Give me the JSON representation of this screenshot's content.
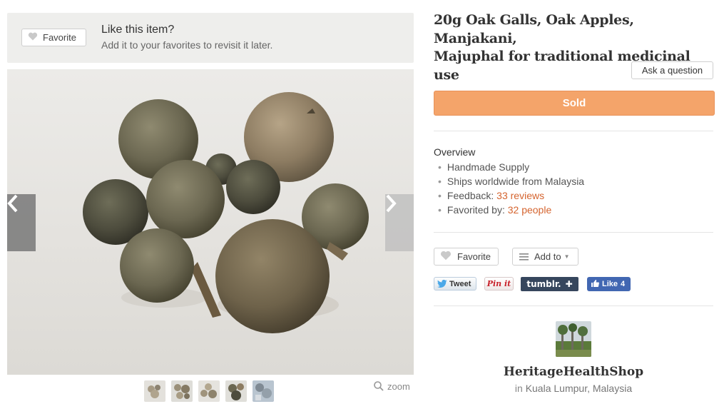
{
  "like_banner": {
    "favorite_label": "Favorite",
    "title": "Like this item?",
    "subtitle": "Add it to your favorites to revisit it later."
  },
  "gallery": {
    "thumbnail_count": 5,
    "zoom_label": "zoom"
  },
  "listing": {
    "title_line1": "20g Oak Galls, Oak Apples, Manjakani,",
    "title_line2": "Majuphal for traditional medicinal use",
    "ask_label": "Ask a question",
    "status_label": "Sold"
  },
  "overview": {
    "heading": "Overview",
    "items": [
      {
        "text": "Handmade Supply",
        "link": ""
      },
      {
        "text": "Ships worldwide from Malaysia",
        "link": ""
      },
      {
        "text": "Feedback: ",
        "link": "33 reviews"
      },
      {
        "text": "Favorited by: ",
        "link": "32 people"
      }
    ]
  },
  "actions": {
    "favorite_label": "Favorite",
    "add_to_label": "Add to"
  },
  "social": {
    "tweet_label": "Tweet",
    "pinit_label": "Pin it",
    "tumblr_label": "tumblr.",
    "like_label": "Like",
    "like_count": "4"
  },
  "shop": {
    "name": "HeritageHealthShop",
    "location_prefix": "in",
    "location": "Kuala Lumpur, Malaysia"
  },
  "colors": {
    "accent_orange": "#f4a46a",
    "link_orange": "#d5642f",
    "tumblr_blue": "#36465d",
    "facebook_blue": "#4267b2"
  }
}
